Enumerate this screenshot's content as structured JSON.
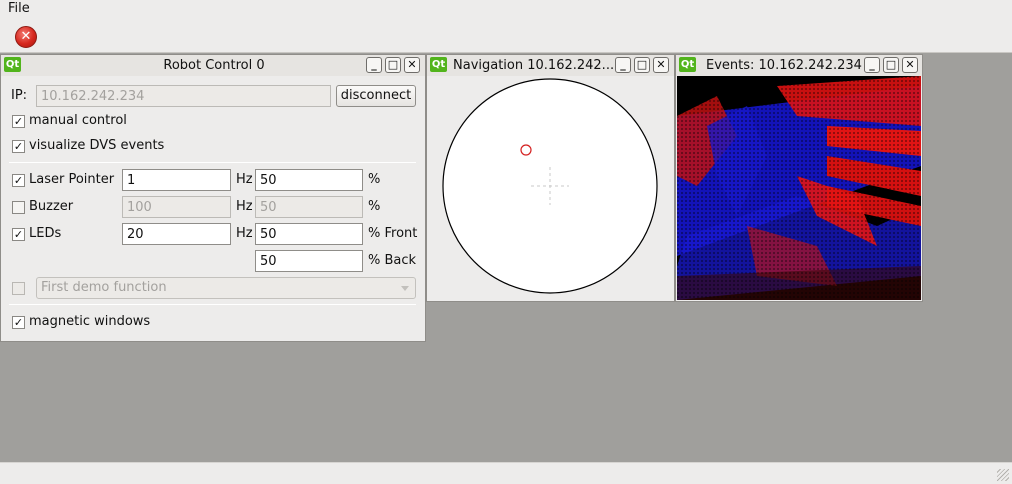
{
  "menubar": {
    "file": "File"
  },
  "toolbar": {
    "quit_glyph": "✕",
    "quit_icon": "close-circle-icon"
  },
  "robot_control": {
    "title": "Robot Control 0",
    "ip_label": "IP:",
    "ip_value": "10.162.242.234",
    "disconnect_label": "disconnect",
    "manual_control_label": "manual control",
    "manual_control_checked": true,
    "visualize_dvs_label": "visualize DVS events",
    "visualize_dvs_checked": true,
    "laser_label": "Laser Pointer",
    "laser_checked": true,
    "laser_hz": "1",
    "laser_percent": "50",
    "buzzer_label": "Buzzer",
    "buzzer_checked": false,
    "buzzer_hz": "100",
    "buzzer_percent": "50",
    "leds_label": "LEDs",
    "leds_checked": true,
    "leds_hz": "20",
    "leds_front": "50",
    "leds_back": "50",
    "hz_unit": "Hz",
    "percent_unit": "%",
    "front_unit": "% Front",
    "back_unit": "% Back",
    "demo_function": "First demo function",
    "demo_checked": false,
    "magnetic_label": "magnetic windows",
    "magnetic_checked": true
  },
  "navigation": {
    "title": "Navigation 10.162.242...."
  },
  "events": {
    "title": "Events: 10.162.242.234"
  },
  "window_buttons": {
    "minimize": "_",
    "maximize": "□",
    "close": "✕"
  },
  "colors": {
    "qt_green": "#52b41c",
    "event_red": "#e01010",
    "event_blue": "#1a1aee",
    "marker_red": "#d42020"
  }
}
